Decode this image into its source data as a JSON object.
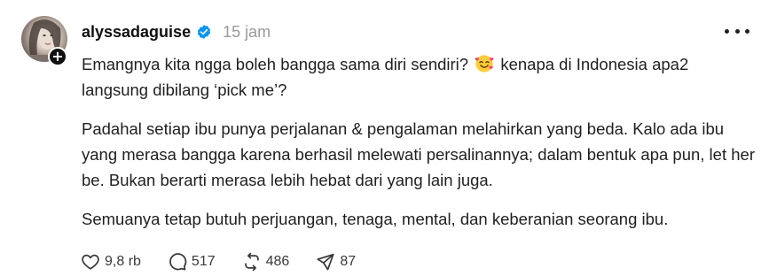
{
  "post": {
    "username": "alyssadaguise",
    "time": "15 jam",
    "icons": {
      "verified": "verified-badge-icon",
      "emoji": "smiling-face-with-hearts-icon",
      "follow": "plus-icon",
      "more": "more-icon"
    },
    "paragraphs": [
      {
        "before_emoji": "Emangnya kita ngga boleh bangga sama diri sendiri?",
        "after_emoji": "kenapa di Indonesia apa2 langsung dibilang ‘pick me’?"
      },
      {
        "text": "Padahal setiap ibu punya perjalanan & pengalaman melahirkan yang beda. Kalo ada ibu yang merasa bangga karena berhasil melewati persalinannya; dalam bentuk apa pun, let her be. Bukan berarti merasa lebih hebat dari yang lain juga."
      },
      {
        "text": "Semuanya tetap butuh perjuangan, tenaga, mental, dan keberanian seorang ibu."
      }
    ],
    "follow_symbol": "+",
    "actions": {
      "likes": "9,8 rb",
      "comments": "517",
      "reposts": "486",
      "shares": "87"
    },
    "colors": {
      "verified": "#0095f6",
      "text": "#1f1f1f",
      "muted": "#9a9a9a"
    }
  }
}
